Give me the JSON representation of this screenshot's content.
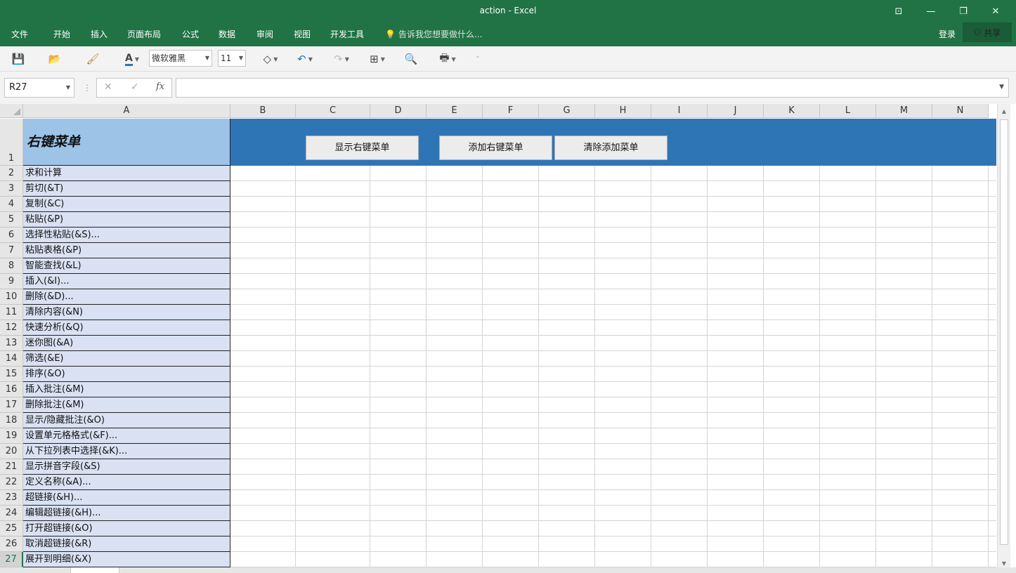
{
  "window": {
    "title": "action - Excel"
  },
  "menu": {
    "tabs": [
      "文件",
      "开始",
      "插入",
      "页面布局",
      "公式",
      "数据",
      "审阅",
      "视图",
      "开发工具"
    ],
    "tell_me": "告诉我您想要做什么...",
    "login": "登录",
    "share": "共享"
  },
  "toolbar": {
    "font_name": "微软雅黑",
    "font_size": "11"
  },
  "formula": {
    "name_box": "R27",
    "fx_label": "fx",
    "content": ""
  },
  "columns": [
    "A",
    "B",
    "C",
    "D",
    "E",
    "F",
    "G",
    "H",
    "I",
    "J",
    "K",
    "L",
    "M",
    "N"
  ],
  "sheet": {
    "header_text": "右键菜单",
    "buttons": [
      "显示右键菜单",
      "添加右键菜单",
      "清除添加菜单"
    ],
    "rows": [
      "求和计算",
      "剪切(&T)",
      "复制(&C)",
      "粘贴(&P)",
      "选择性粘贴(&S)...",
      "粘贴表格(&P)",
      "智能查找(&L)",
      "插入(&I)...",
      "删除(&D)...",
      "清除内容(&N)",
      "快速分析(&Q)",
      "迷你图(&A)",
      "筛选(&E)",
      "排序(&O)",
      "插入批注(&M)",
      "删除批注(&M)",
      "显示/隐藏批注(&O)",
      "设置单元格格式(&F)...",
      "从下拉列表中选择(&K)...",
      "显示拼音字段(&S)",
      "定义名称(&A)...",
      "超链接(&H)...",
      "编辑超链接(&H)...",
      "打开超链接(&O)",
      "取消超链接(&R)",
      "展开到明细(&X)"
    ],
    "active_row": 27
  }
}
